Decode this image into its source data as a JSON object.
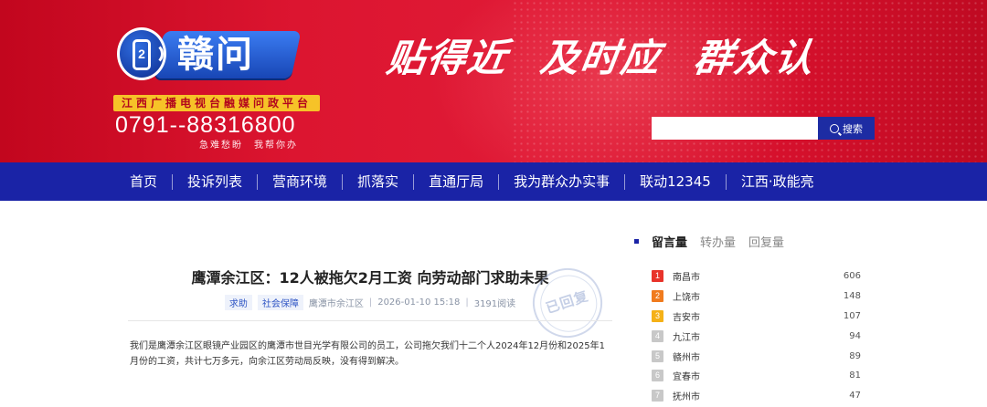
{
  "header": {
    "logo_number": "2",
    "logo_text": "赣问",
    "platform": "江西广播电视台融媒问政平台",
    "hotline": "0791--88316800",
    "slogan_small": [
      "急难愁盼",
      "我帮你办"
    ],
    "slogan": [
      "贴得近",
      "及时应",
      "群众认"
    ],
    "search": {
      "placeholder": "",
      "button_label": "搜索"
    }
  },
  "nav": {
    "items": [
      {
        "label": "首页"
      },
      {
        "label": "投诉列表"
      },
      {
        "label": "营商环境"
      },
      {
        "label": "抓落实"
      },
      {
        "label": "直通厅局"
      },
      {
        "label": "我为群众办实事"
      },
      {
        "label": "联动12345"
      },
      {
        "label": "江西·政能亮"
      }
    ]
  },
  "article": {
    "title": "鹰潭余江区：12人被拖欠2月工资 向劳动部门求助未果",
    "tags": [
      "求助",
      "社会保障"
    ],
    "location": "鹰潭市余江区",
    "datetime": "2026-01-10 15:18",
    "reads": "3191阅读",
    "stamp": "已回复",
    "content": "我们是鹰潭余江区眼镜产业园区的鹰潭市世目光学有限公司的员工，公司拖欠我们十二个人2024年12月份和2025年1月份的工资，共计七万多元，向余江区劳动局反映，没有得到解决。"
  },
  "ranking": {
    "tabs": [
      {
        "label": "留言量",
        "active": true
      },
      {
        "label": "转办量",
        "active": false
      },
      {
        "label": "回复量",
        "active": false
      }
    ],
    "rows": [
      {
        "rank": "1",
        "city": "南昌市",
        "count": "606",
        "color": "#e8332a"
      },
      {
        "rank": "2",
        "city": "上饶市",
        "count": "148",
        "color": "#f07b1e"
      },
      {
        "rank": "3",
        "city": "吉安市",
        "count": "107",
        "color": "#f5b117"
      },
      {
        "rank": "4",
        "city": "九江市",
        "count": "94",
        "color": "#c8c8c8"
      },
      {
        "rank": "5",
        "city": "赣州市",
        "count": "89",
        "color": "#c8c8c8"
      },
      {
        "rank": "6",
        "city": "宜春市",
        "count": "81",
        "color": "#c8c8c8"
      },
      {
        "rank": "7",
        "city": "抚州市",
        "count": "47",
        "color": "#c8c8c8"
      }
    ]
  },
  "colors": {
    "banner_red": "#d8122e",
    "nav_blue": "#1a23a6",
    "platform_yellow": "#f6c328"
  }
}
